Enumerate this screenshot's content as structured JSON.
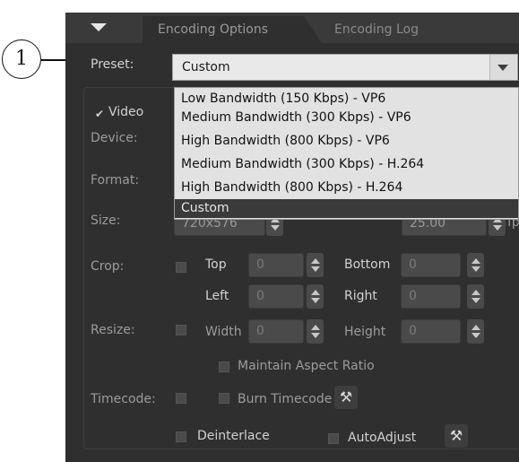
{
  "callout": {
    "number": "1"
  },
  "tabs": [
    {
      "label": "Encoding Options"
    },
    {
      "label": "Encoding Log"
    }
  ],
  "preset": {
    "label": "Preset:",
    "value": "Custom",
    "options": [
      "Low Bandwidth (150 Kbps) - VP6",
      "Medium Bandwidth (300 Kbps) - VP6",
      "High Bandwidth (800 Kbps) - VP6",
      "Medium Bandwidth (300 Kbps) - H.264",
      "High Bandwidth (800 Kbps) - H.264",
      "Custom"
    ],
    "selected_index": 5
  },
  "video": {
    "checkbox_label": "Video",
    "checked": true,
    "device_label": "Device:",
    "format_label": "Format:",
    "size_label": "Size:",
    "size_value": "720x576",
    "framerate_value": "25.00",
    "framerate_unit": "fps"
  },
  "crop": {
    "label": "Crop:",
    "top_label": "Top",
    "top_value": "0",
    "bottom_label": "Bottom",
    "bottom_value": "0",
    "left_label": "Left",
    "left_value": "0",
    "right_label": "Right",
    "right_value": "0"
  },
  "resize": {
    "label": "Resize:",
    "width_label": "Width",
    "width_value": "0",
    "height_label": "Height",
    "height_value": "0",
    "aspect_label": "Maintain Aspect Ratio"
  },
  "timecode": {
    "label": "Timecode:",
    "burn_label": "Burn Timecode"
  },
  "deinterlace_label": "Deinterlace",
  "autoadjust_label": "AutoAdjust",
  "icons": {
    "collapse": "triangle-down-icon",
    "wrench": "wrench-icon"
  },
  "colors": {
    "panel": "#2f2f2f",
    "selection": "#3a3a3a",
    "dropdown": "#e2e2e2"
  }
}
